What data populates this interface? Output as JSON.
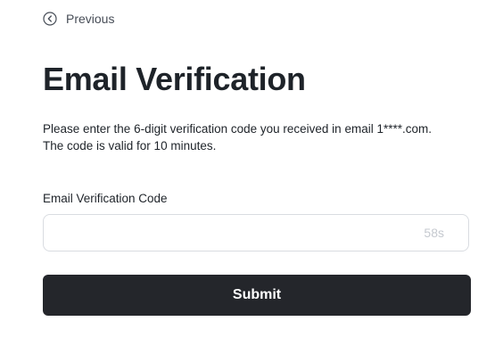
{
  "nav": {
    "back_label": "Previous",
    "back_icon": "chevron-left-circle-icon"
  },
  "header": {
    "title": "Email Verification"
  },
  "description": {
    "line1": "Please enter the 6-digit verification code you received in email 1****.com.",
    "line2": "The code is valid for 10 minutes."
  },
  "form": {
    "code_label": "Email Verification Code",
    "code_value": "",
    "code_placeholder": "",
    "countdown": "58s",
    "submit_label": "Submit"
  },
  "colors": {
    "primary_button": "#24262b",
    "text": "#1e2329",
    "muted": "#c5c9cf"
  }
}
